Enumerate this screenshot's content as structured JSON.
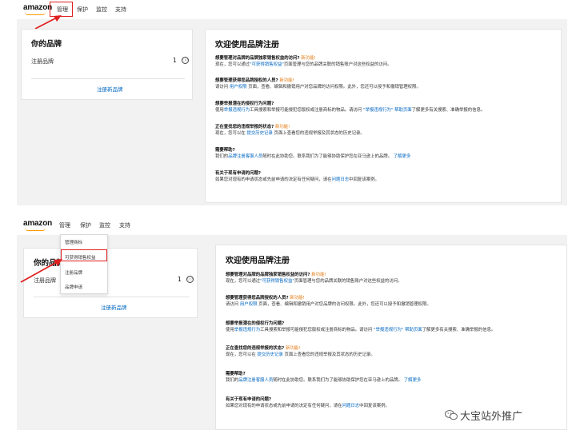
{
  "logo": "amazon",
  "nav": {
    "manage": "管理",
    "protect": "保护",
    "monitor": "监控",
    "support": "支持"
  },
  "brands_panel": {
    "title": "你的品牌",
    "row_label": "注册品牌",
    "count": "1",
    "info_icon": "ⓘ",
    "register_link": "注册新品牌"
  },
  "welcome": {
    "title": "欢迎使用品牌注册",
    "new_badge": "新功能!",
    "s1_q": "想要管理对品牌的品牌独家销售权益的访问?",
    "s1_a1": "现在，您可以通过",
    "s1_link": "\"可获得销售权益\"",
    "s1_a2": "页面管理与您的品牌关联的销售账户对这些权益的访问。",
    "s2_q": "想要管理获得您品牌授权的人员?",
    "s2_a1": "请访问",
    "s2_link": "用户权限",
    "s2_a2": "页面，查看、编辑和撤销用户对您品牌的访问权限。此外，您还可以授予和撤销管理权限。",
    "s3_q": "想要举报潜在的侵权行为问题?",
    "s3_a1": "使用",
    "s3_link1": "举报违规行为",
    "s3_a2": "工具搜索和举报可能侵犯您版权或注册商标的物品。请访问",
    "s3_link2": "\"举报违规行为\"",
    "s3_a3": "帮助页面",
    "s3_a4": "了解更多有关搜索、准确举报的信息。",
    "s4_q": "正在查找您的违规举报的状态?",
    "s4_a1": "现在，您可以在",
    "s4_link": "提交历史记录",
    "s4_a2": "页面上查看您的违规举报及其状态的历史记录。",
    "s5_q": "需要帮助?",
    "s5_a1": "我们的",
    "s5_link1": "品牌注册客服人员",
    "s5_a2": "随时在此协助您。联系我们为了能够协助保护您在亚马逊上的品牌。",
    "s5_link2": "了解更多",
    "s6_q": "有关于现有申请的问题?",
    "s6_a1": "如果您对现有的申请状态或先前申请的决定有任何疑问，请在",
    "s6_link": "问题日志",
    "s6_a2": "中回复该案例。"
  },
  "dropdown": {
    "items": [
      "管理商标",
      "可获得销售权益",
      "注册品牌",
      "品牌申请"
    ]
  },
  "watermark": "大宝站外推广",
  "colors": {
    "link": "#0066c0",
    "new_badge": "#e47911",
    "highlight": "#e02020",
    "background": "#f2f2f2"
  }
}
